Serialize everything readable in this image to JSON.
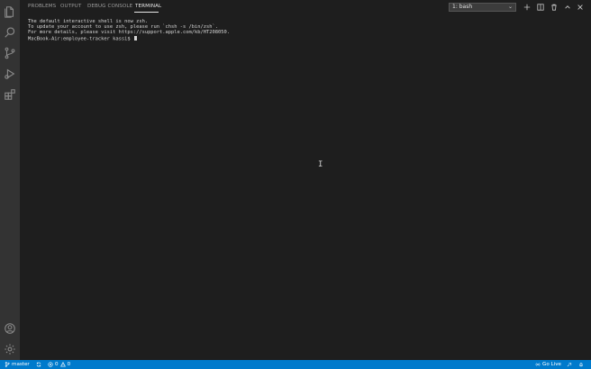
{
  "panel": {
    "tabs": [
      {
        "label": "PROBLEMS"
      },
      {
        "label": "OUTPUT"
      },
      {
        "label": "DEBUG CONSOLE"
      },
      {
        "label": "TERMINAL",
        "active": true
      }
    ],
    "terminal_selector": {
      "value": "1: bash"
    }
  },
  "terminal": {
    "lines": [
      "The default interactive shell is now zsh.",
      "To update your account to use zsh, please run `chsh -s /bin/zsh`.",
      "For more details, please visit https://support.apple.com/kb/HT208050."
    ],
    "prompt": "MacBook-Air:employee-tracker kassi$ "
  },
  "status_bar": {
    "branch": "master",
    "errors": "0",
    "warnings": "0",
    "go_live": "Go Live"
  },
  "colors": {
    "activity_bar": "#333333",
    "editor_bg": "#1e1e1e",
    "status_bar": "#007acc"
  },
  "icons": {
    "activity_bar": [
      "files-icon",
      "search-icon",
      "source-control-icon",
      "run-debug-icon",
      "extensions-icon",
      "account-icon",
      "settings-gear-icon"
    ],
    "panel_actions": [
      "add-terminal-icon",
      "split-terminal-icon",
      "trash-icon",
      "chevron-up-icon",
      "close-icon"
    ]
  }
}
